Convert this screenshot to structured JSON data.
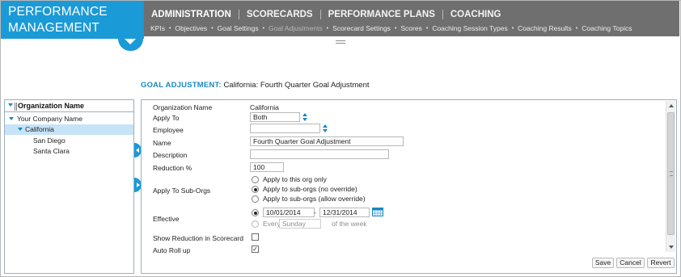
{
  "brand": {
    "line1": "PERFORMANCE",
    "line2": "MANAGEMENT",
    "menu_icon": "chevron-down-icon"
  },
  "topnav": {
    "main": [
      {
        "label": "ADMINISTRATION",
        "active": true
      },
      {
        "label": "SCORECARDS",
        "active": false
      },
      {
        "label": "PERFORMANCE PLANS",
        "active": false
      },
      {
        "label": "COACHING",
        "active": false
      }
    ],
    "sub": [
      {
        "label": "KPIs",
        "active": false
      },
      {
        "label": "Objectives",
        "active": false
      },
      {
        "label": "Goal Settings",
        "active": false
      },
      {
        "label": "Goal Adjustments",
        "active": true
      },
      {
        "label": "Scorecard Settings",
        "active": false
      },
      {
        "label": "Scores",
        "active": false
      },
      {
        "label": "Coaching Session Types",
        "active": false
      },
      {
        "label": "Coaching Results",
        "active": false
      },
      {
        "label": "Coaching Topics",
        "active": false
      }
    ]
  },
  "page": {
    "title_label": "GOAL ADJUSTMENT:",
    "title_value": "California: Fourth Quarter Goal Adjustment"
  },
  "org_tree": {
    "header": "Organization Name",
    "items": [
      {
        "label": "Your Company Name",
        "expanded": true,
        "selected": false
      },
      {
        "label": "California",
        "expanded": true,
        "selected": true
      },
      {
        "label": "San Diego",
        "expanded": false,
        "selected": false
      },
      {
        "label": "Santa Clara",
        "expanded": false,
        "selected": false
      }
    ]
  },
  "form": {
    "org_name_label": "Organization Name",
    "org_name_value": "California",
    "apply_to_label": "Apply To",
    "apply_to_value": "Both",
    "employee_label": "Employee",
    "employee_value": "",
    "name_label": "Name",
    "name_value": "Fourth Quarter Goal Adjustment",
    "description_label": "Description",
    "description_value": "",
    "reduction_label": "Reduction %",
    "reduction_value": "100",
    "sub_orgs_label": "Apply To Sub-Orgs",
    "sub_orgs_options": [
      {
        "label": "Apply to this org only",
        "checked": false
      },
      {
        "label": "Apply to sub-orgs (no override)",
        "checked": true
      },
      {
        "label": "Apply to sub-orgs (allow override)",
        "checked": false
      }
    ],
    "effective_label": "Effective",
    "effective_start": "10/01/2014",
    "effective_dash": "-",
    "effective_end": "12/31/2014",
    "every_label": "Every",
    "every_day": "Sunday",
    "of_week_label": "of the week",
    "show_reduction_label": "Show Reduction in Scorecard",
    "show_reduction_checked": false,
    "auto_rollup_label": "Auto Roll up",
    "auto_rollup_checked": true,
    "auto_rollup_mark": "✓"
  },
  "buttons": {
    "save": "Save",
    "cancel": "Cancel",
    "revert": "Revert"
  },
  "colors": {
    "brand_blue": "#1a9ad6",
    "nav_gray": "#6f6f6f",
    "title_blue": "#1a87c2",
    "selection": "#c6e3f7"
  }
}
